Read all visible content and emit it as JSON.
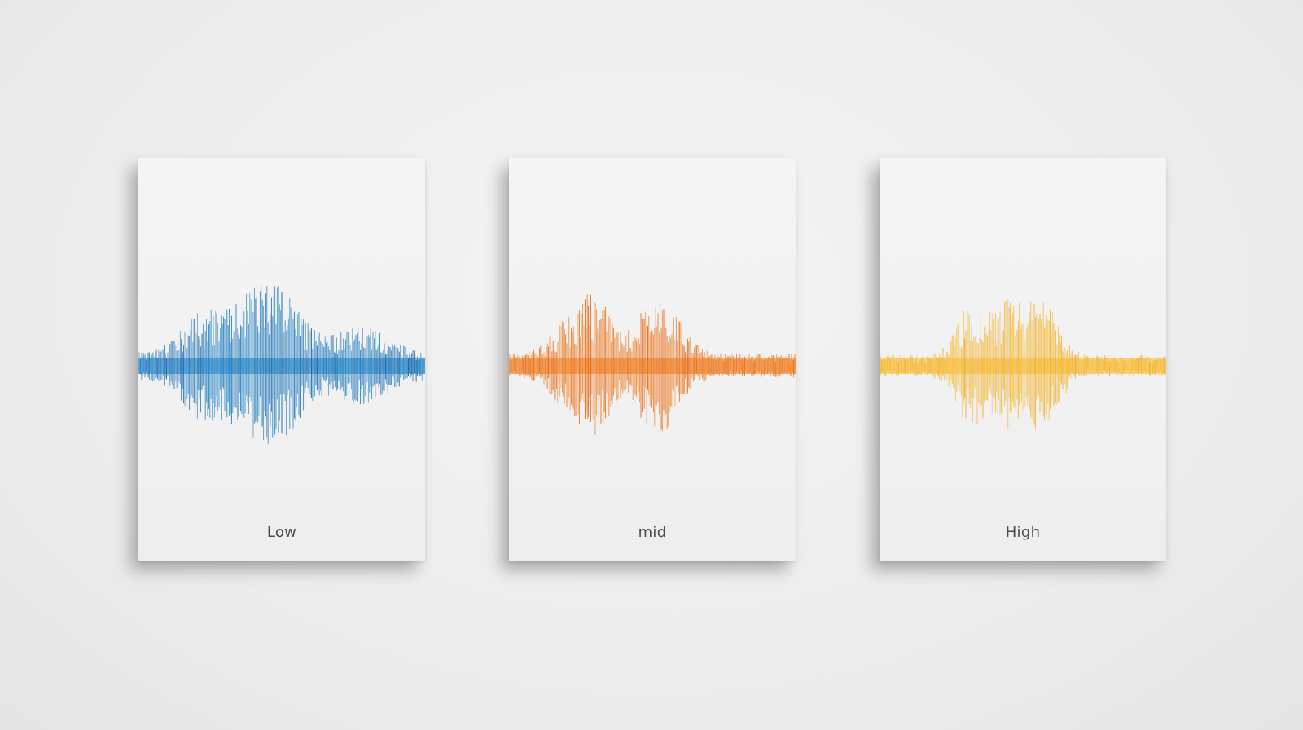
{
  "posters": [
    {
      "label": "Low",
      "color": "#1a7fc4",
      "color_dark": "#0d5fa8",
      "level": 0.95
    },
    {
      "label": "mid",
      "color": "#f07a1a",
      "color_dark": "#e8620c",
      "level": 0.85
    },
    {
      "label": "High",
      "color": "#f7b928",
      "color_dark": "#f2a81c",
      "level": 0.8
    }
  ]
}
